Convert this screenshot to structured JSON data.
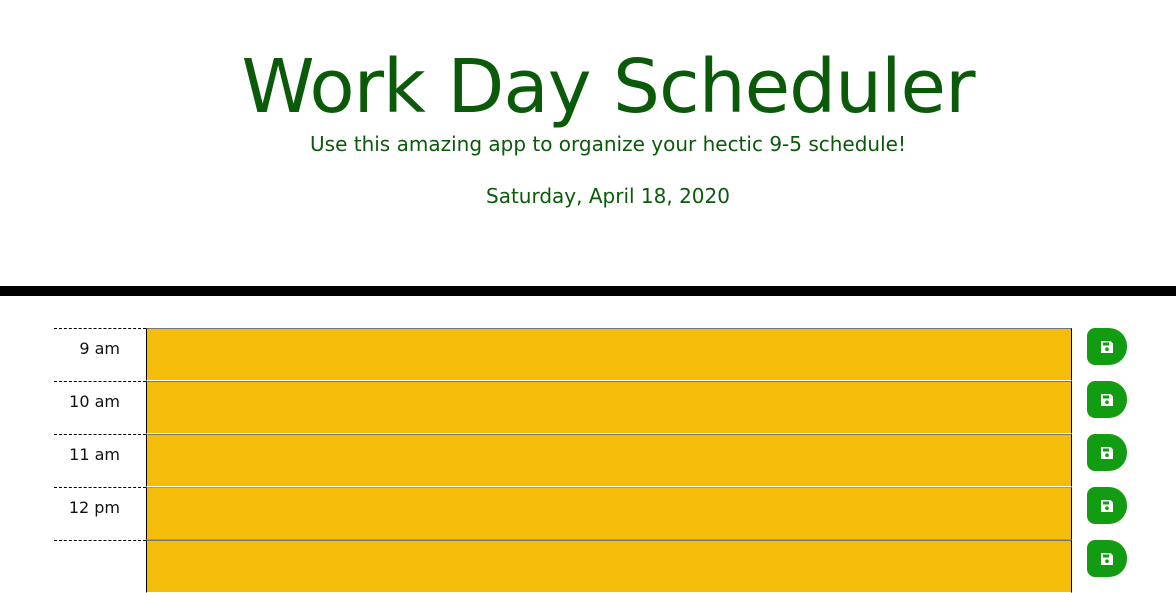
{
  "header": {
    "title": "Work Day Scheduler",
    "subtitle": "Use this amazing app to organize your hectic 9-5 schedule!",
    "current_day": "Saturday, April 18, 2020"
  },
  "colors": {
    "title": "#0a5a0a",
    "present": "#f4bd09",
    "save_button": "#119c11",
    "divider": "#000000"
  },
  "time_blocks": [
    {
      "hour": "9 am",
      "description": "",
      "state": "present"
    },
    {
      "hour": "10 am",
      "description": "",
      "state": "present"
    },
    {
      "hour": "11 am",
      "description": "",
      "state": "present"
    },
    {
      "hour": "12 pm",
      "description": "",
      "state": "present"
    }
  ],
  "save_button_icon": "floppy-disk-icon"
}
